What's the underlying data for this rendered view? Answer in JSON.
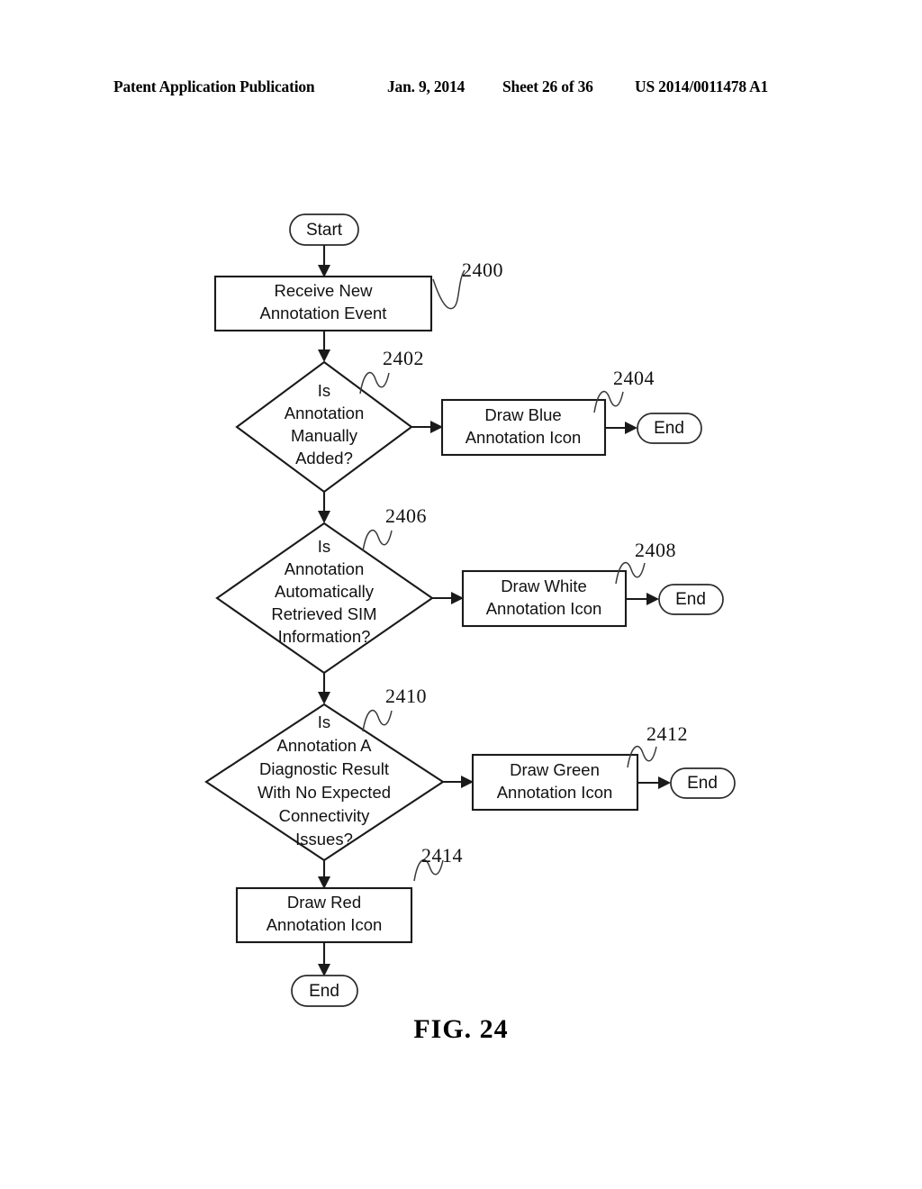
{
  "document": {
    "header": {
      "publication": "Patent Application Publication",
      "date": "Jan. 9, 2014",
      "sheet": "Sheet 26 of 36",
      "patent_number": "US 2014/0011478 A1"
    },
    "figure_caption": "FIG. 24"
  },
  "flowchart": {
    "title": "FIG. 24",
    "nodes": {
      "start": {
        "label": "Start",
        "type": "terminator"
      },
      "receive_event": {
        "line1": "Receive New",
        "line2": "Annotation Event",
        "type": "process",
        "ref": "2400"
      },
      "decision_manual": {
        "line1": "Is",
        "line2": "Annotation",
        "line3": "Manually",
        "line4": "Added?",
        "type": "decision",
        "ref": "2402"
      },
      "draw_blue": {
        "line1": "Draw Blue",
        "line2": "Annotation Icon",
        "type": "process",
        "ref": "2404",
        "color": "Blue"
      },
      "end_blue": {
        "label": "End",
        "type": "terminator"
      },
      "decision_sim": {
        "line1": "Is",
        "line2": "Annotation",
        "line3": "Automatically",
        "line4": "Retrieved SIM",
        "line5": "Information?",
        "type": "decision",
        "ref": "2406"
      },
      "draw_white": {
        "line1": "Draw White",
        "line2": "Annotation Icon",
        "type": "process",
        "ref": "2408",
        "color": "White"
      },
      "end_white": {
        "label": "End",
        "type": "terminator"
      },
      "decision_diagnostic": {
        "line1": "Is",
        "line2": "Annotation A",
        "line3": "Diagnostic Result",
        "line4": "With No Expected",
        "line5": "Connectivity",
        "line6": "Issues?",
        "type": "decision",
        "ref": "2410"
      },
      "draw_green": {
        "line1": "Draw Green",
        "line2": "Annotation Icon",
        "type": "process",
        "ref": "2412",
        "color": "Green"
      },
      "end_green": {
        "label": "End",
        "type": "terminator"
      },
      "draw_red": {
        "line1": "Draw Red",
        "line2": "Annotation Icon",
        "type": "process",
        "ref": "2414",
        "color": "Red"
      },
      "end_red": {
        "label": "End",
        "type": "terminator"
      }
    },
    "reference_numerals": {
      "n2400": "2400",
      "n2402": "2402",
      "n2404": "2404",
      "n2406": "2406",
      "n2408": "2408",
      "n2410": "2410",
      "n2412": "2412",
      "n2414": "2414"
    }
  }
}
